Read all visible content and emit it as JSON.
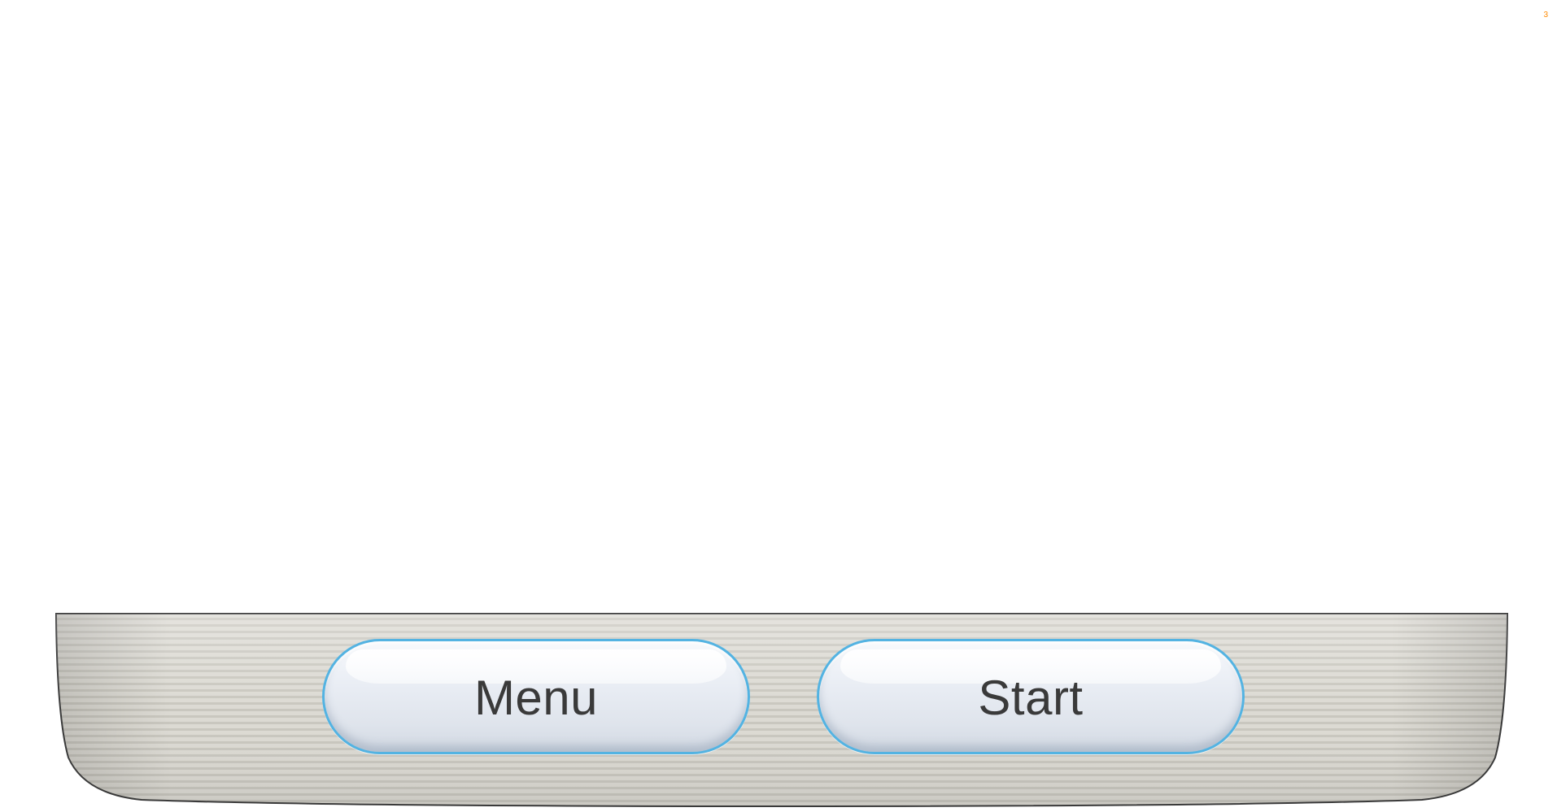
{
  "corner_mark": {
    "text": "3",
    "color": "#ff8a00"
  },
  "dock": {
    "buttons": [
      {
        "label": "Menu"
      },
      {
        "label": "Start"
      }
    ]
  },
  "colors": {
    "button_border": "#53b3e2",
    "button_text": "#3a3a3a",
    "dock_fill": "#d9d7cf",
    "dock_outline": "#3c3c3c"
  }
}
